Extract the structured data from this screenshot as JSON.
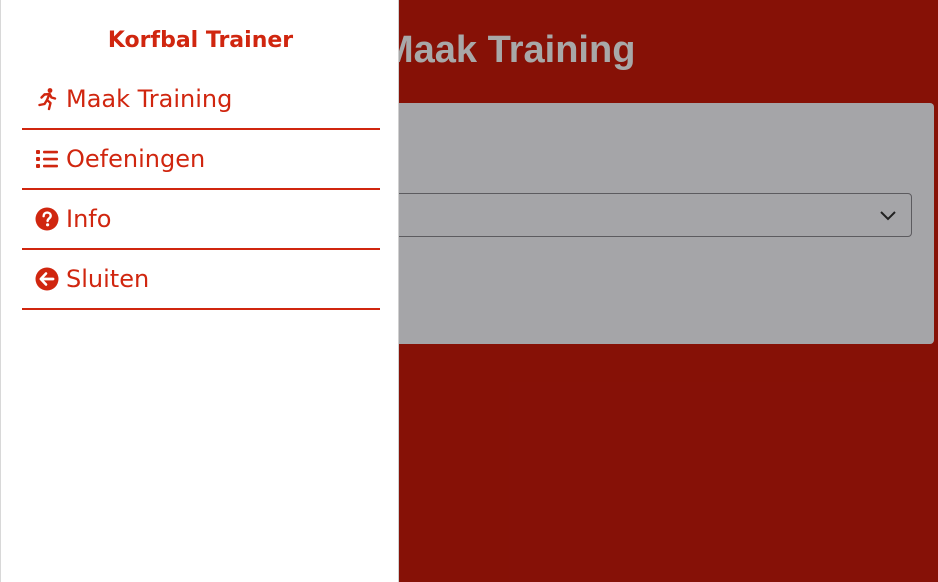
{
  "drawer": {
    "title": "Korfbal Trainer",
    "items": [
      {
        "label": "Maak Training",
        "icon": "running-icon"
      },
      {
        "label": "Oefeningen",
        "icon": "list-icon"
      },
      {
        "label": "Info",
        "icon": "question-circle-icon"
      },
      {
        "label": "Sluiten",
        "icon": "arrow-circle-left-icon"
      }
    ]
  },
  "page": {
    "title": "Maak Training"
  },
  "colors": {
    "accent": "#d0260f",
    "background_dimmed": "#870f06",
    "card_dimmed": "#9b9a9d",
    "drawer_bg": "#ffffff"
  }
}
